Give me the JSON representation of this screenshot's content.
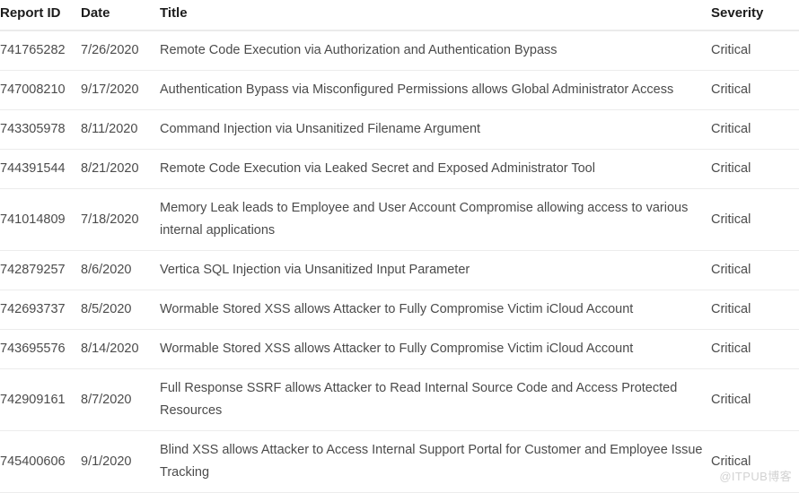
{
  "table": {
    "columns": [
      {
        "key": "report_id",
        "label": "Report ID"
      },
      {
        "key": "date",
        "label": "Date"
      },
      {
        "key": "title",
        "label": "Title"
      },
      {
        "key": "severity",
        "label": "Severity"
      }
    ],
    "rows": [
      {
        "report_id": "741765282",
        "date": "7/26/2020",
        "title": "Remote Code Execution via Authorization and Authentication Bypass",
        "severity": "Critical"
      },
      {
        "report_id": "747008210",
        "date": "9/17/2020",
        "title": "Authentication Bypass via Misconfigured Permissions allows Global Administrator Access",
        "severity": "Critical"
      },
      {
        "report_id": "743305978",
        "date": "8/11/2020",
        "title": "Command Injection via Unsanitized Filename Argument",
        "severity": "Critical"
      },
      {
        "report_id": "744391544",
        "date": "8/21/2020",
        "title": "Remote Code Execution via Leaked Secret and Exposed Administrator Tool",
        "severity": "Critical"
      },
      {
        "report_id": "741014809",
        "date": "7/18/2020",
        "title": "Memory Leak leads to Employee and User Account Compromise allowing access to various internal applications",
        "severity": "Critical"
      },
      {
        "report_id": "742879257",
        "date": "8/6/2020",
        "title": "Vertica SQL Injection via Unsanitized Input Parameter",
        "severity": "Critical"
      },
      {
        "report_id": "742693737",
        "date": "8/5/2020",
        "title": "Wormable Stored XSS allows Attacker to Fully Compromise Victim iCloud Account",
        "severity": "Critical"
      },
      {
        "report_id": "743695576",
        "date": "8/14/2020",
        "title": "Wormable Stored XSS allows Attacker to Fully Compromise Victim iCloud Account",
        "severity": "Critical"
      },
      {
        "report_id": "742909161",
        "date": "8/7/2020",
        "title": "Full Response SSRF allows Attacker to Read Internal Source Code and Access Protected Resources",
        "severity": "Critical"
      },
      {
        "report_id": "745400606",
        "date": "9/1/2020",
        "title": "Blind XSS allows Attacker to Access Internal Support Portal for Customer and Employee Issue Tracking",
        "severity": "Critical"
      }
    ]
  },
  "watermark": {
    "text": "@ITPUB博客"
  },
  "colors": {
    "header_text": "#1c1c1c",
    "body_text": "#4b4b4b",
    "row_divider": "#ececec",
    "header_divider": "#ebebeb",
    "background": "#ffffff",
    "watermark": "#d2d2d2"
  }
}
